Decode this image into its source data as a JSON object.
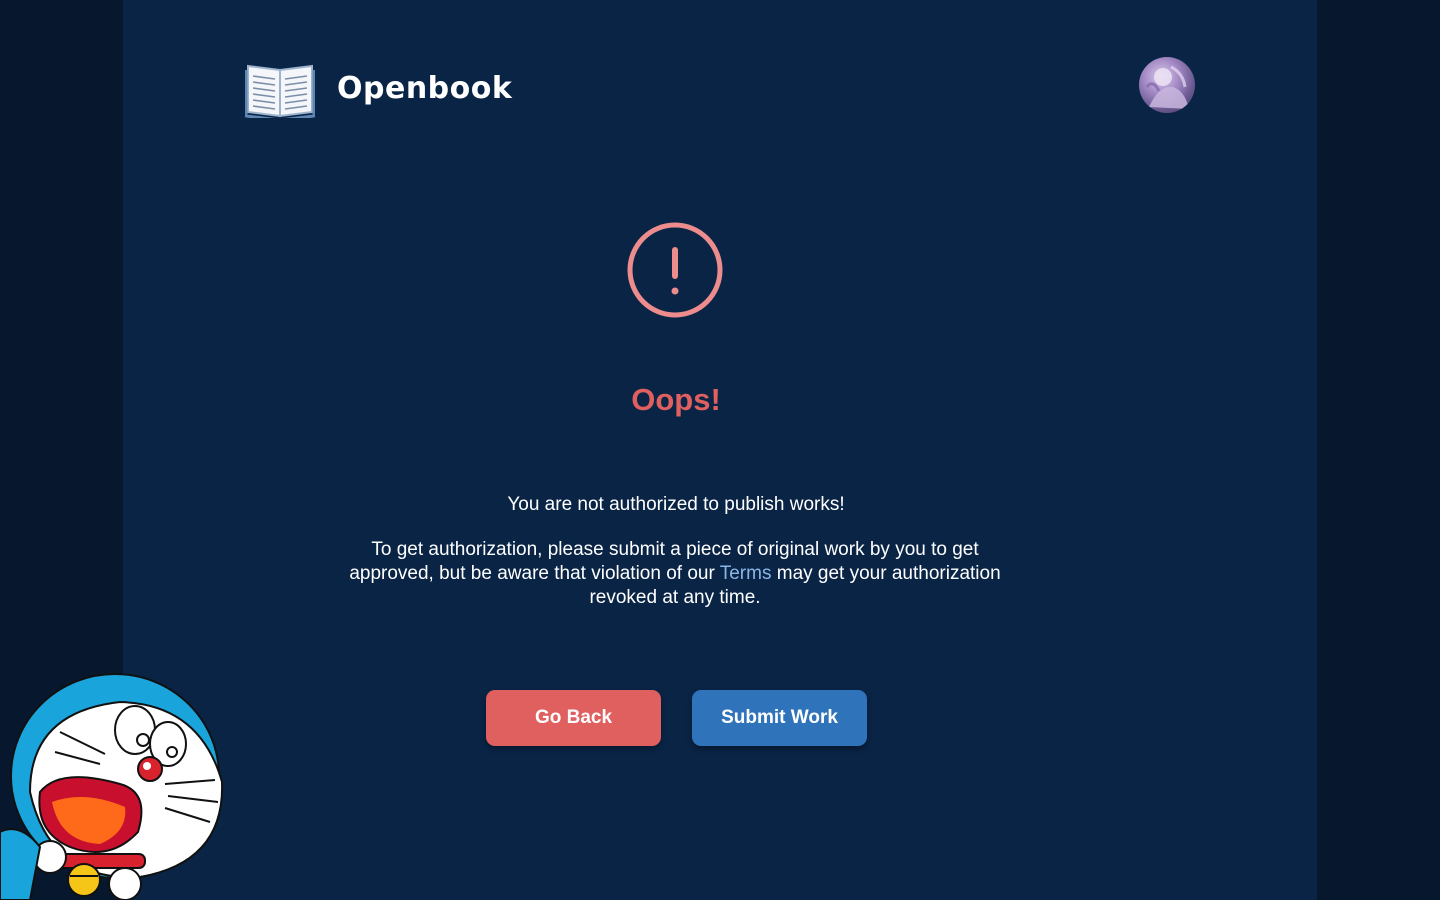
{
  "header": {
    "brand": "Openbook",
    "logo_icon": "open-book-icon",
    "avatar_icon": "user-avatar"
  },
  "alert": {
    "icon": "exclamation-circle-icon",
    "title": "Oops!",
    "message": "You are not authorized to publish works!",
    "detail_before": "To get authorization, please submit a piece of original work by you to get approved, but be aware that violation of our ",
    "terms_link": "Terms",
    "detail_after": " may get your authorization revoked at any time."
  },
  "actions": {
    "back_label": "Go Back",
    "submit_label": "Submit Work"
  },
  "colors": {
    "background": "#07172d",
    "panel": "#0a2446",
    "accent_red": "#e05f5f",
    "accent_blue": "#2f73bb",
    "link": "#8ab6e8"
  }
}
